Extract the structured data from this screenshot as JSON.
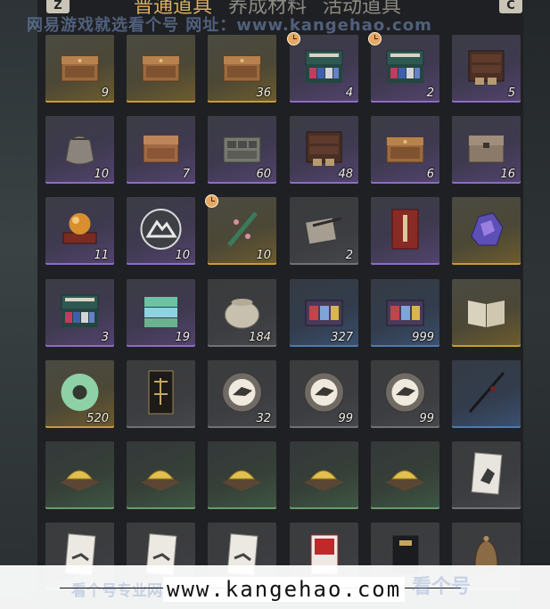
{
  "header": {
    "left_key": "Z",
    "right_key": "C",
    "tabs": [
      {
        "label": "普通道具",
        "active": true
      },
      {
        "label": "养成材料",
        "active": false
      },
      {
        "label": "活动道具",
        "active": false
      }
    ],
    "watermark": "网易游戏就选看个号  网址：www.kangehao.com"
  },
  "colors": {
    "gold": "#c79a3b",
    "purple": "#8d6cc2",
    "blue": "#4f7ab0",
    "green": "#6a9a6e",
    "active_tab": "#d8b160"
  },
  "items": [
    {
      "icon": "wooden-chest-icon",
      "rarity": "gold",
      "count": "9",
      "timed": false
    },
    {
      "icon": "wooden-chest-icon",
      "rarity": "gold",
      "count": "",
      "timed": false
    },
    {
      "icon": "wooden-chest-icon",
      "rarity": "gold",
      "count": "36",
      "timed": false
    },
    {
      "icon": "fabric-box-icon",
      "rarity": "purple",
      "count": "4",
      "timed": true
    },
    {
      "icon": "fabric-box-icon",
      "rarity": "purple",
      "count": "2",
      "timed": true
    },
    {
      "icon": "dark-cabinet-icon",
      "rarity": "purple",
      "count": "5",
      "timed": false
    },
    {
      "icon": "cloth-pouch-icon",
      "rarity": "purple",
      "count": "10",
      "timed": false
    },
    {
      "icon": "carved-chest-icon",
      "rarity": "purple",
      "count": "7",
      "timed": false
    },
    {
      "icon": "tool-case-icon",
      "rarity": "purple",
      "count": "60",
      "timed": false
    },
    {
      "icon": "dark-cabinet-icon",
      "rarity": "purple",
      "count": "48",
      "timed": false
    },
    {
      "icon": "wooden-chest-icon",
      "rarity": "purple",
      "count": "6",
      "timed": false
    },
    {
      "icon": "plain-chest-icon",
      "rarity": "purple",
      "count": "16",
      "timed": false
    },
    {
      "icon": "orb-stand-icon",
      "rarity": "purple",
      "count": "11",
      "timed": false
    },
    {
      "icon": "mountain-emblem-icon",
      "rarity": "purple",
      "count": "10",
      "timed": false
    },
    {
      "icon": "jade-flute-icon",
      "rarity": "gold",
      "count": "10",
      "timed": true
    },
    {
      "icon": "brush-scroll-icon",
      "rarity": "gray",
      "count": "2",
      "timed": false
    },
    {
      "icon": "red-letter-icon",
      "rarity": "purple",
      "count": "",
      "timed": false
    },
    {
      "icon": "crystal-ore-icon",
      "rarity": "gold",
      "count": "",
      "timed": false
    },
    {
      "icon": "fabric-box-icon",
      "rarity": "purple",
      "count": "3",
      "timed": false
    },
    {
      "icon": "cloth-stack-icon",
      "rarity": "purple",
      "count": "19",
      "timed": false
    },
    {
      "icon": "ceramic-jar-icon",
      "rarity": "gray",
      "count": "184",
      "timed": false
    },
    {
      "icon": "gift-box-icon",
      "rarity": "blue",
      "count": "327",
      "timed": false
    },
    {
      "icon": "gift-box-icon",
      "rarity": "blue",
      "count": "999",
      "timed": false
    },
    {
      "icon": "open-book-icon",
      "rarity": "gold",
      "count": "",
      "timed": false
    },
    {
      "icon": "jade-disc-icon",
      "rarity": "gold",
      "count": "520",
      "timed": false
    },
    {
      "icon": "dark-banner-icon",
      "rarity": "gray",
      "count": "",
      "timed": false
    },
    {
      "icon": "bird-token-icon",
      "rarity": "gray",
      "count": "32",
      "timed": false
    },
    {
      "icon": "bird-token-icon",
      "rarity": "gray",
      "count": "99",
      "timed": false
    },
    {
      "icon": "bird-token-icon",
      "rarity": "gray",
      "count": "99",
      "timed": false
    },
    {
      "icon": "spear-icon",
      "rarity": "blue",
      "count": "",
      "timed": false
    },
    {
      "icon": "gold-ingots-icon",
      "rarity": "green",
      "count": "",
      "timed": false
    },
    {
      "icon": "gold-ingots-icon",
      "rarity": "green",
      "count": "",
      "timed": false
    },
    {
      "icon": "gold-ingots-icon",
      "rarity": "green",
      "count": "",
      "timed": false
    },
    {
      "icon": "gold-ingots-icon",
      "rarity": "green",
      "count": "",
      "timed": false
    },
    {
      "icon": "gold-ingots-icon",
      "rarity": "green",
      "count": "",
      "timed": false
    },
    {
      "icon": "horse-card-icon",
      "rarity": "gray",
      "count": "",
      "timed": false
    },
    {
      "icon": "ink-card-icon",
      "rarity": "gray",
      "count": "",
      "timed": false
    },
    {
      "icon": "ink-card-icon",
      "rarity": "gray",
      "count": "",
      "timed": false
    },
    {
      "icon": "ink-card-icon",
      "rarity": "gray",
      "count": "",
      "timed": false
    },
    {
      "icon": "red-card-icon",
      "rarity": "gray",
      "count": "",
      "timed": false
    },
    {
      "icon": "black-card-icon",
      "rarity": "gray",
      "count": "",
      "timed": false
    },
    {
      "icon": "bronze-bell-icon",
      "rarity": "gray",
      "count": "",
      "timed": false
    }
  ],
  "footer": {
    "url": "www.kangehao.com",
    "watermark": "看个号专业网易游戏账号交易平台",
    "logo": "看个号"
  }
}
